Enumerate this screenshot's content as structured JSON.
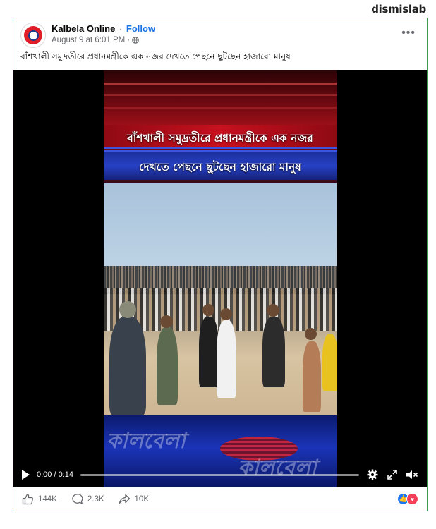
{
  "watermark": "dismislab",
  "post": {
    "page_name": "Kalbela Online",
    "separator": "·",
    "follow_label": "Follow",
    "timestamp": "August 9 at 6:01 PM",
    "meta_dot": "·",
    "privacy_icon": "globe-icon",
    "more_label": "•••",
    "caption": "বাঁশখালী সমুদ্রতীরে প্রধানমন্ত্রীকে এক নজর দেখতে পেছনে ছুটছেন হাজারো মানুষ"
  },
  "video": {
    "headline_line1": "বাঁশখালী সমুদ্রতীরে প্রধানমন্ত্রীকে এক নজর",
    "headline_line2": "দেখতে পেছনে ছুটছেন হাজারো মানুষ",
    "brand_overlay": "কালবেলা",
    "time_display": "0:00 / 0:14",
    "progress": 0,
    "colors": {
      "banner_red": "#b3131d",
      "banner_blue": "#2741c5"
    }
  },
  "stats": {
    "likes": "144K",
    "comments": "2.3K",
    "shares": "10K",
    "reaction_icons": [
      "like-icon",
      "love-icon"
    ]
  },
  "colors": {
    "accent": "#1b74e4",
    "border": "#3f9a4f"
  }
}
